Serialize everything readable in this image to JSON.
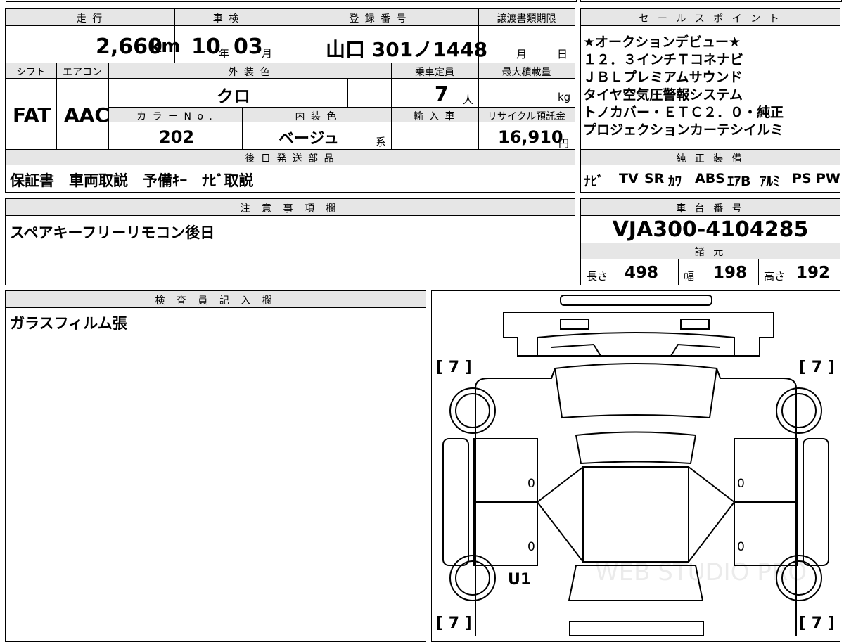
{
  "basic": {
    "mileage_label": "走 行",
    "mileage_value": "2,660",
    "mileage_unit": "km",
    "inspection_label": "車 検",
    "inspection_year": "10",
    "inspection_year_unit": "年",
    "inspection_month": "03",
    "inspection_month_unit": "月",
    "registration_label": "登 録 番 号",
    "registration_value": "山口 301ノ1448",
    "transfer_label": "譲渡書類期限",
    "transfer_month_unit": "月",
    "transfer_day_unit": "日",
    "shift_label": "シフト",
    "shift_value": "FAT",
    "aircon_label": "エアコン",
    "aircon_value": "AAC",
    "exterior_label": "外 装 色",
    "exterior_value": "クロ",
    "capacity_label": "乗車定員",
    "capacity_value": "7",
    "capacity_unit": "人",
    "maxload_label": "最大積載量",
    "maxload_unit": "kg",
    "color_no_label": "カ ラ ー N o .",
    "color_no_value": "202",
    "interior_label": "内 装 色",
    "interior_value": "ベージュ",
    "interior_unit": "系",
    "import_label": "輸 入 車",
    "recycle_label": "リサイクル預託金",
    "recycle_value": "16,910",
    "recycle_unit": "円",
    "later_parts_label": "後 日 発 送 部 品",
    "later_parts_value": "保証書　車両取説　予備ｷｰ　ﾅﾋﾞ取説"
  },
  "sales": {
    "label": "セ ー ル ス ポ イ ン ト",
    "lines": [
      "★オークションデビュー★",
      "１２．３インチＴコネナビ",
      "ＪＢＬプレミアムサウンド",
      "タイヤ空気圧警報システム",
      "トノカバー・ＥＴＣ２．０・純正",
      "プロジェクションカーテシイルミ"
    ]
  },
  "equipment": {
    "label": "純 正 装 備",
    "items": [
      "ﾅﾋﾞ",
      "TV",
      "SR",
      "ｶﾜ",
      "ABS",
      "ｴｱB",
      "ｱﾙﾐ",
      "PS",
      "PW"
    ]
  },
  "notes": {
    "label": "注 意 事 項 欄",
    "value": "スペアキーフリーリモコン後日"
  },
  "chassis": {
    "label": "車 台 番 号",
    "value": "VJA300-4104285",
    "specs_label": "諸 元",
    "length_label": "長さ",
    "length_value": "498",
    "width_label": "幅",
    "width_value": "198",
    "height_label": "高さ",
    "height_value": "192"
  },
  "inspector": {
    "label": "検 査 員 記 入 欄",
    "value": "ガラスフィルム張"
  },
  "diagram": {
    "tire_fl": "[ 7 ]",
    "tire_fr": "[ 7 ]",
    "tire_rl": "[ 7 ]",
    "tire_rr": "[ 7 ]",
    "door_fl": "0",
    "door_fr": "0",
    "door_rl": "0",
    "door_rr": "0",
    "damage_mark": "U1",
    "watermark": "WEB STUDIO PRO"
  }
}
